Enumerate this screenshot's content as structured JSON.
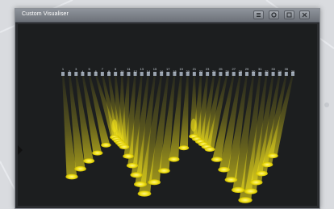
{
  "window": {
    "title": "Custom Visualiser",
    "buttons": [
      {
        "name": "menu-icon"
      },
      {
        "name": "settings-icon"
      },
      {
        "name": "restore-icon"
      },
      {
        "name": "close-icon"
      }
    ]
  },
  "visualiser": {
    "beam_color": "#f2e21a",
    "fixture_count": 36,
    "fixture_labels": [
      "1",
      "2",
      "3",
      "4",
      "5",
      "6",
      "7",
      "8",
      "9",
      "10",
      "11",
      "12",
      "13",
      "14",
      "15",
      "16",
      "17",
      "18",
      "19",
      "20",
      "21",
      "22",
      "23",
      "24",
      "25",
      "26",
      "27",
      "28",
      "29",
      "30",
      "31",
      "32",
      "33",
      "34",
      "35",
      "36"
    ]
  }
}
